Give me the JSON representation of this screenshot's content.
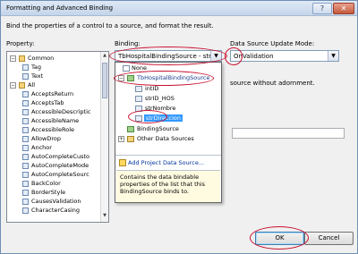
{
  "window": {
    "title": "Formatting and Advanced Binding",
    "help_glyph": "?",
    "close_glyph": "✕"
  },
  "description": "Bind the properties of a control to a source, and format the result.",
  "property": {
    "label": "Property:",
    "items": [
      {
        "text": "Common",
        "expander": "−",
        "kind": "folder"
      },
      {
        "text": "Tag",
        "kind": "prop"
      },
      {
        "text": "Text",
        "kind": "prop"
      },
      {
        "text": "All",
        "expander": "−",
        "kind": "folder"
      },
      {
        "text": "AcceptsReturn",
        "kind": "prop"
      },
      {
        "text": "AcceptsTab",
        "kind": "prop"
      },
      {
        "text": "AccessibleDescriptic",
        "kind": "prop"
      },
      {
        "text": "AccessibleName",
        "kind": "prop"
      },
      {
        "text": "AccessibleRole",
        "kind": "prop"
      },
      {
        "text": "AllowDrop",
        "kind": "prop"
      },
      {
        "text": "Anchor",
        "kind": "prop"
      },
      {
        "text": "AutoCompleteCusto",
        "kind": "prop"
      },
      {
        "text": "AutoCompleteMode",
        "kind": "prop"
      },
      {
        "text": "AutoCompleteSourc",
        "kind": "prop"
      },
      {
        "text": "BackColor",
        "kind": "prop"
      },
      {
        "text": "BorderStyle",
        "kind": "prop"
      },
      {
        "text": "CausesValidation",
        "kind": "prop"
      },
      {
        "text": "CharacterCasing",
        "kind": "prop"
      }
    ]
  },
  "binding": {
    "label": "Binding:",
    "value": "TbHospitalBindingSource - strDirecc",
    "dropdown": {
      "none": "None",
      "source": "TbHospitalBindingSource",
      "fields": [
        "intID",
        "strID_HOS",
        "strNombre",
        "strDireccion"
      ],
      "selected": "strDireccion",
      "binding_sources": "BindingSource",
      "other_sources": "Other Data Sources",
      "add_link": "Add Project Data Source...",
      "help": "Contains the data bindable properties of the list that this BindingSource binds to."
    }
  },
  "update_mode": {
    "label": "Data Source Update Mode:",
    "value": "OnValidation"
  },
  "right_text": "source without adornment.",
  "buttons": {
    "ok": "OK",
    "cancel": "Cancel"
  },
  "colors": {
    "annotation": "#c8102e",
    "selection": "#3399ff"
  }
}
